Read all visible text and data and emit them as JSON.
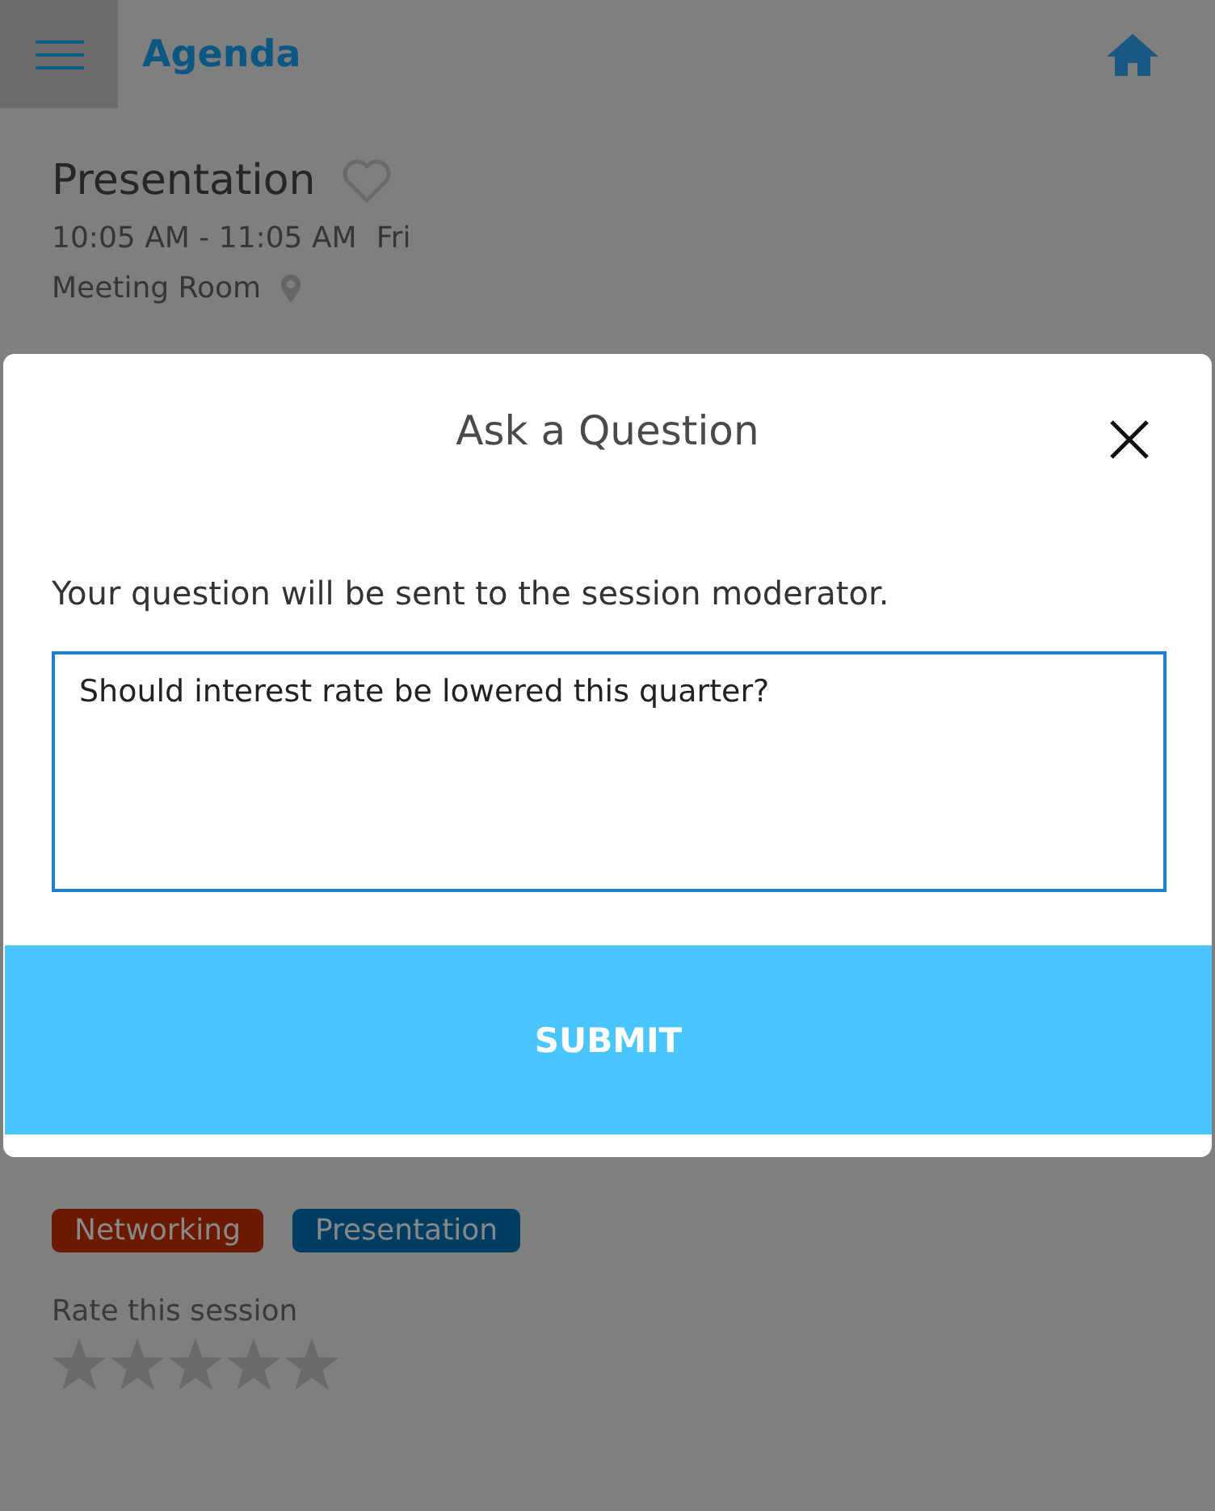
{
  "header": {
    "title": "Agenda"
  },
  "session": {
    "title": "Presentation",
    "favorite": false,
    "time": "10:05 AM - 11:05 AM",
    "day": "Fri",
    "location": "Meeting Room",
    "tags": [
      {
        "label": "Networking",
        "color": "#6b1a00"
      },
      {
        "label": "Presentation",
        "color": "#003d63"
      }
    ],
    "rate_label": "Rate this session",
    "stars": 0
  },
  "dialog": {
    "title": "Ask a Question",
    "message": "Your question will be sent to the session moderator.",
    "question": {
      "value": "Should interest rate be lowered this quarter?"
    },
    "submit": "SUBMIT"
  }
}
